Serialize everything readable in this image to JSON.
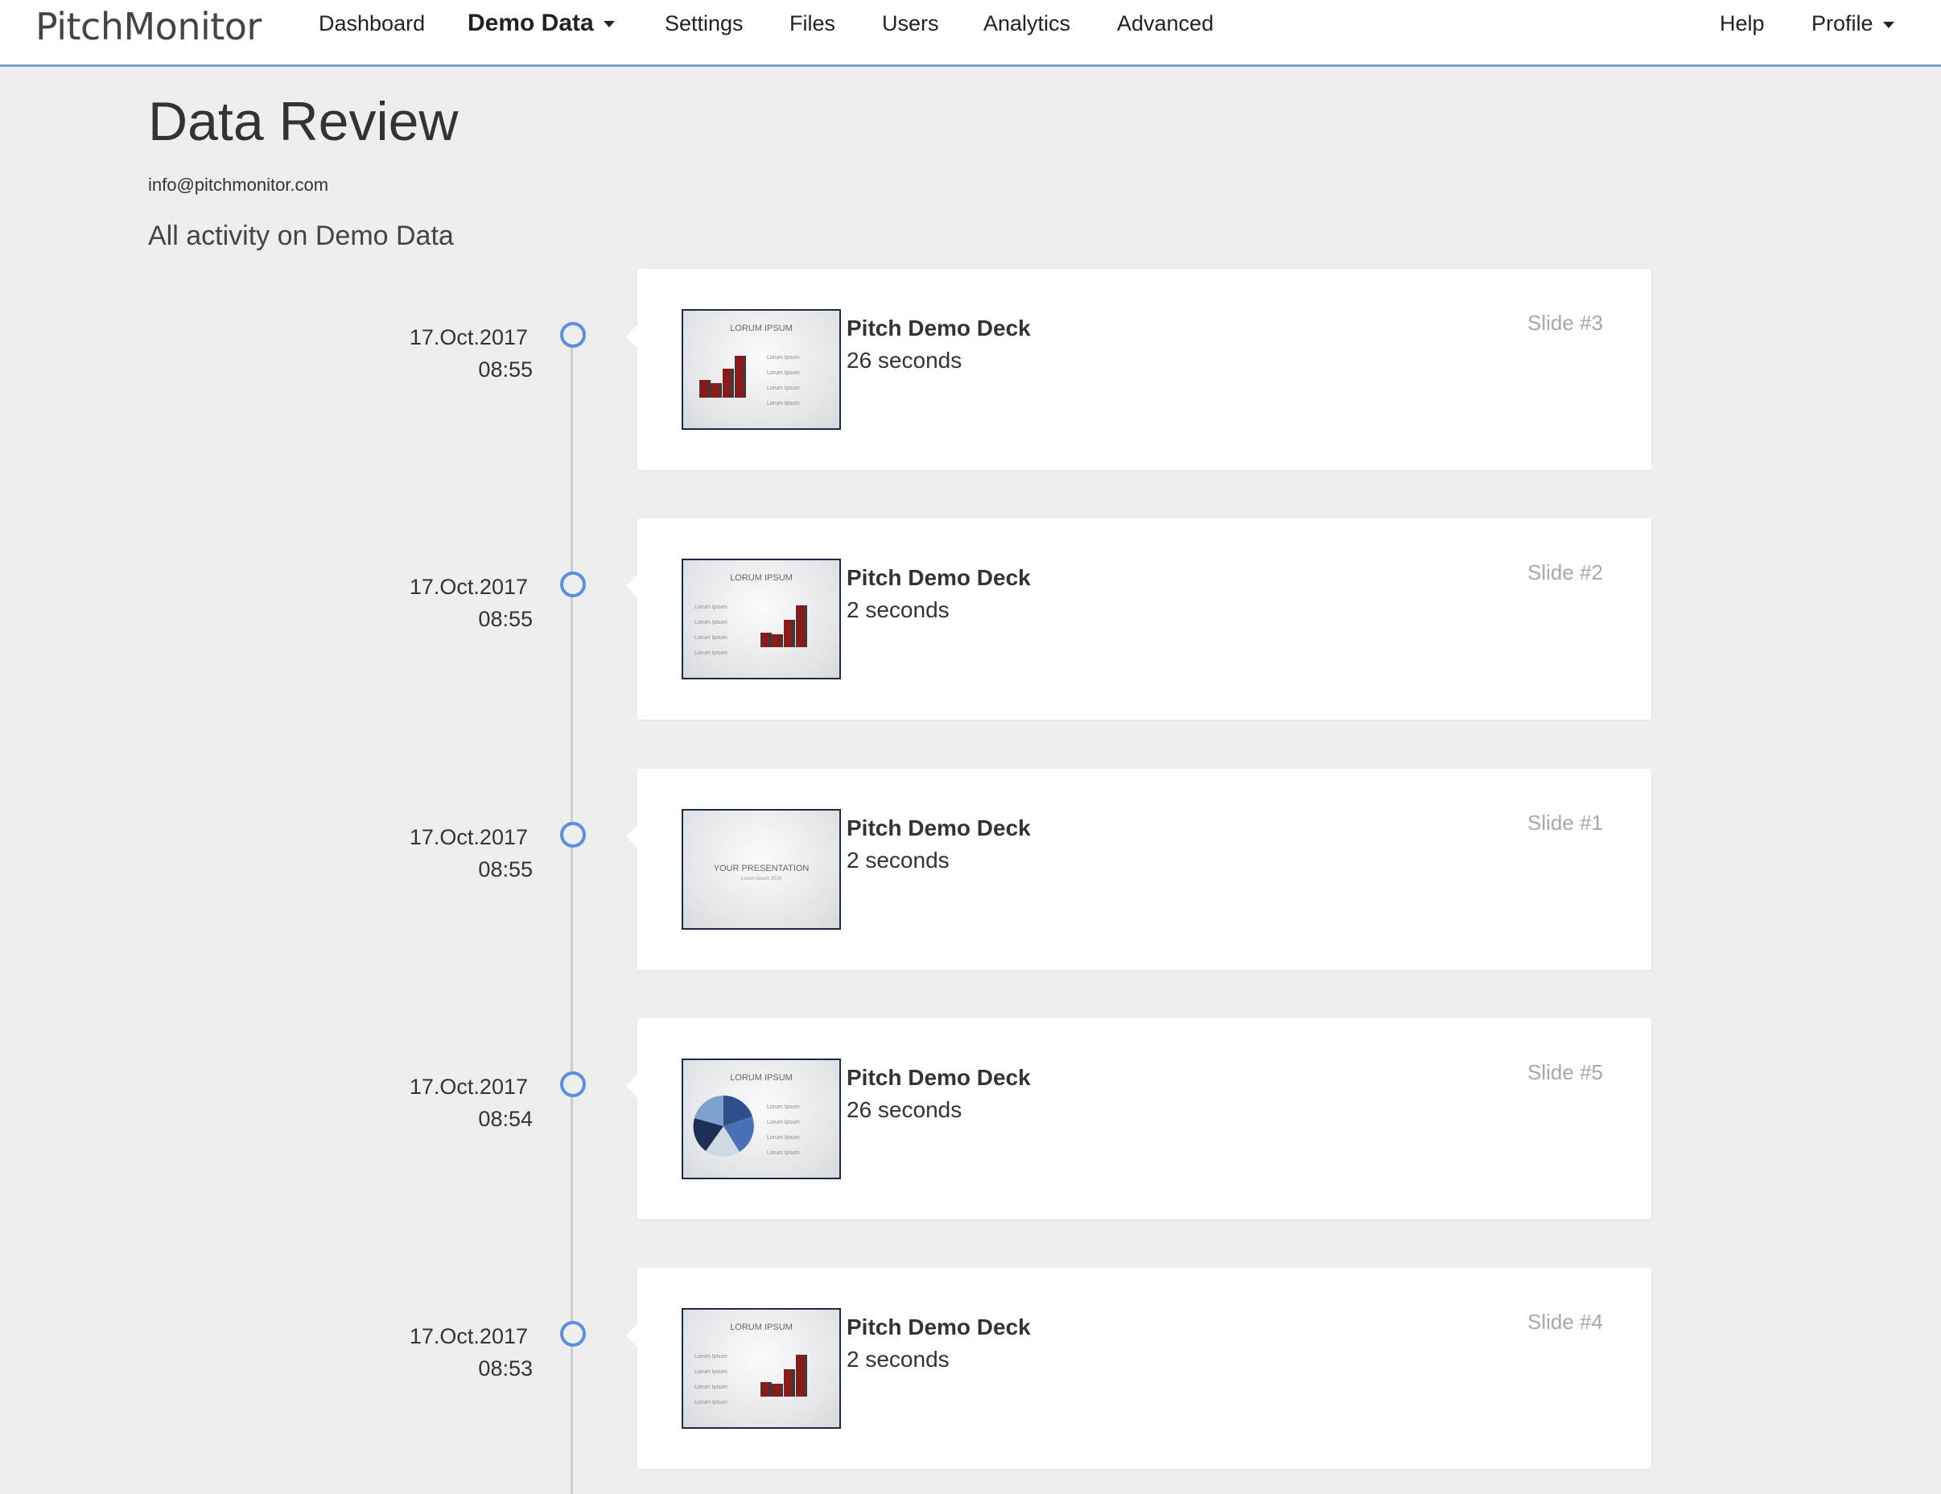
{
  "navbar": {
    "logo": "PitchMonitor",
    "items": [
      {
        "label": "Dashboard"
      },
      {
        "label": "Demo Data"
      },
      {
        "label": "Settings"
      },
      {
        "label": "Files"
      },
      {
        "label": "Users"
      },
      {
        "label": "Analytics"
      },
      {
        "label": "Advanced"
      }
    ],
    "help_label": "Help",
    "profile_label": "Profile"
  },
  "header": {
    "title": "Data Review",
    "email": "info@pitchmonitor.com",
    "subtitle": "All activity on Demo Data"
  },
  "colors": {
    "accent": "#5b8fe0",
    "bar_red": "#8b1a1a",
    "bar_dark": "#3a3a3a",
    "thumb_border": "#1b2a47"
  },
  "timeline": [
    {
      "date": "17.Oct.2017",
      "time": "08:55",
      "deck": "Pitch Demo Deck",
      "duration": "26 seconds",
      "slide": "Slide #3",
      "thumb": {
        "heading": "LORUM IPSUM",
        "items": [
          "Lorum Ipsum",
          "Lorum Ipsum",
          "Lorum Ipsum",
          "Lorum Ipsum"
        ]
      }
    },
    {
      "date": "17.Oct.2017",
      "time": "08:55",
      "deck": "Pitch Demo Deck",
      "duration": "2 seconds",
      "slide": "Slide #2",
      "thumb": {
        "heading": "LORUM IPSUM",
        "items": [
          "Lorum Ipsum",
          "Lorum Ipsum",
          "Lorum Ipsum",
          "Lorum Ipsum"
        ]
      }
    },
    {
      "date": "17.Oct.2017",
      "time": "08:55",
      "deck": "Pitch Demo Deck",
      "duration": "2 seconds",
      "slide": "Slide #1",
      "thumb": {
        "heading": "YOUR PRESENTATION",
        "subheading": "Lorum Ipsum 2016"
      }
    },
    {
      "date": "17.Oct.2017",
      "time": "08:54",
      "deck": "Pitch Demo Deck",
      "duration": "26 seconds",
      "slide": "Slide #5",
      "thumb": {
        "heading": "LORUM IPSUM",
        "items": [
          "Lorum Ipsum",
          "Lorum Ipsum",
          "Lorum Ipsum",
          "Lorum Ipsum"
        ]
      }
    },
    {
      "date": "17.Oct.2017",
      "time": "08:53",
      "deck": "Pitch Demo Deck",
      "duration": "2 seconds",
      "slide": "Slide #4",
      "thumb": {
        "heading": "LORUM IPSUM",
        "items": [
          "Lorum Ipsum",
          "Lorum Ipsum",
          "Lorum Ipsum",
          "Lorum Ipsum"
        ]
      }
    }
  ]
}
